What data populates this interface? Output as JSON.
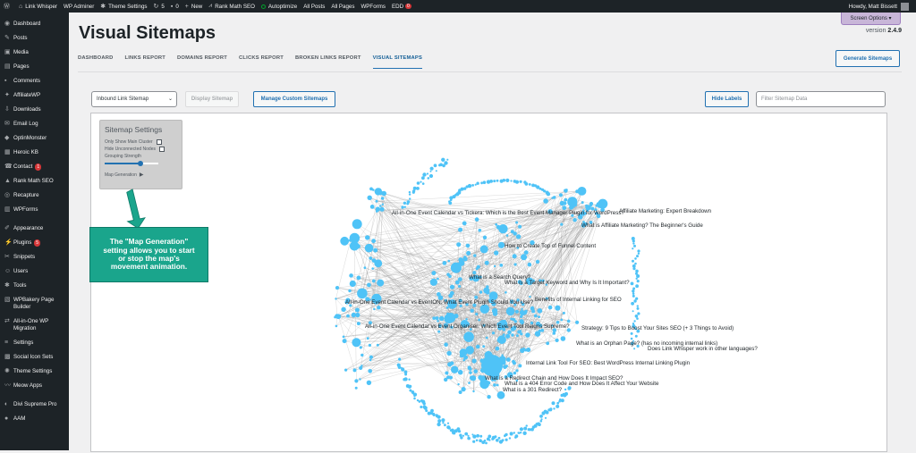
{
  "admin_bar": {
    "items": [
      "Link Whisper",
      "WP Adminer",
      "Theme Settings",
      "5",
      "0",
      "New",
      "Rank Math SEO",
      "Autoptimize",
      "All Posts",
      "All Pages",
      "WPForms",
      "EDD"
    ],
    "edd_badge": "0",
    "user": "Howdy, Matt Bissett"
  },
  "sidebar": {
    "items": [
      {
        "label": "Dashboard",
        "icon": "dashboard-icon"
      },
      {
        "label": "Posts",
        "icon": "pin-icon"
      },
      {
        "label": "Media",
        "icon": "media-icon"
      },
      {
        "label": "Pages",
        "icon": "pages-icon"
      },
      {
        "label": "Comments",
        "icon": "comment-icon"
      },
      {
        "label": "AffiliateWP",
        "icon": "affiliate-icon"
      },
      {
        "label": "Downloads",
        "icon": "download-icon"
      },
      {
        "label": "Email Log",
        "icon": "email-icon"
      },
      {
        "label": "OptinMonster",
        "icon": "optinmonster-icon"
      },
      {
        "label": "Heroic KB",
        "icon": "book-icon"
      },
      {
        "label": "Contact",
        "icon": "contact-icon",
        "badge": "1"
      },
      {
        "label": "Rank Math SEO",
        "icon": "chart-icon"
      },
      {
        "label": "Recapture",
        "icon": "recapture-icon"
      },
      {
        "label": "WPForms",
        "icon": "forms-icon"
      },
      {
        "label": "Appearance",
        "icon": "brush-icon"
      },
      {
        "label": "Plugins",
        "icon": "plugin-icon",
        "badge": "5"
      },
      {
        "label": "Snippets",
        "icon": "code-icon"
      },
      {
        "label": "Users",
        "icon": "user-icon"
      },
      {
        "label": "Tools",
        "icon": "wrench-icon"
      },
      {
        "label": "WPBakery Page Builder",
        "icon": "builder-icon"
      },
      {
        "label": "All-in-One WP Migration",
        "icon": "migration-icon"
      },
      {
        "label": "Settings",
        "icon": "settings-icon"
      },
      {
        "label": "Social Icon Sets",
        "icon": "social-icon"
      },
      {
        "label": "Theme Settings",
        "icon": "gear-icon"
      },
      {
        "label": "Meow Apps",
        "icon": "meow-icon"
      },
      {
        "label": "Divi Supreme Pro",
        "icon": "divi-icon"
      },
      {
        "label": "AAM",
        "icon": "aam-icon"
      }
    ]
  },
  "header": {
    "title": "Visual Sitemaps",
    "version_prefix": "version",
    "version": "2.4.9",
    "screen_options": "Screen Options ▾"
  },
  "tabs": [
    "DASHBOARD",
    "LINKS REPORT",
    "DOMAINS REPORT",
    "CLICKS REPORT",
    "BROKEN LINKS REPORT",
    "VISUAL SITEMAPS"
  ],
  "active_tab": "VISUAL SITEMAPS",
  "generate_button": "Generate Sitemaps",
  "controls": {
    "select_value": "Inbound Link Sitemap",
    "display_button": "Display Sitemap",
    "manage_button": "Manage Custom Sitemaps",
    "hide_labels_button": "Hide Labels",
    "filter_placeholder": "Filter Sitemap Data"
  },
  "settings_panel": {
    "title": "Sitemap Settings",
    "options": [
      "Only Show Main Cluster",
      "Hide Unconnected Nodes"
    ],
    "slider_label": "Grouping Strength",
    "slider_level": 0.65,
    "map_generation": "Map Generation"
  },
  "callout": "The \"Map Generation\" setting allows you to start or stop the map's movement animation.",
  "node_labels": [
    "All-in-One Event Calendar vs Tickera: Which is the Best Event Manager Plugin for WordPress?",
    "Affiliate Marketing: Expert Breakdown",
    "What is Affiliate Marketing? The Beginner's Guide",
    "How to Create Top of Funnel Content",
    "What is a Search Query?",
    "What is a Target Keyword and Why Is It Important?",
    "All-in-One Event Calendar vs EventON: What Event Plugin Should You Use?",
    "Benefits of Internal Linking for SEO",
    "All-in-One Event Calendar vs Event Organiser: Which Event Tool Reigns Supreme?",
    "Strategy: 9 Tips to Boost Your Sites SEO (+ 3 Things to Avoid)",
    "What is an Orphan Page? (has no incoming internal links)",
    "Does Link Whisper work in other languages?",
    "Internal Link Tool For SEO: Best WordPress Internal Linking Plugin",
    "What is a Redirect Chain and How Does It Impact SEO?",
    "What is a 404 Error Code and How Does It Affect Your Website",
    "What is a 301 Redirect?"
  ],
  "colors": {
    "node": "#4fc3f7",
    "accent": "#2271b1",
    "callout": "#1aa58c",
    "admin_bg": "#1d2327"
  }
}
